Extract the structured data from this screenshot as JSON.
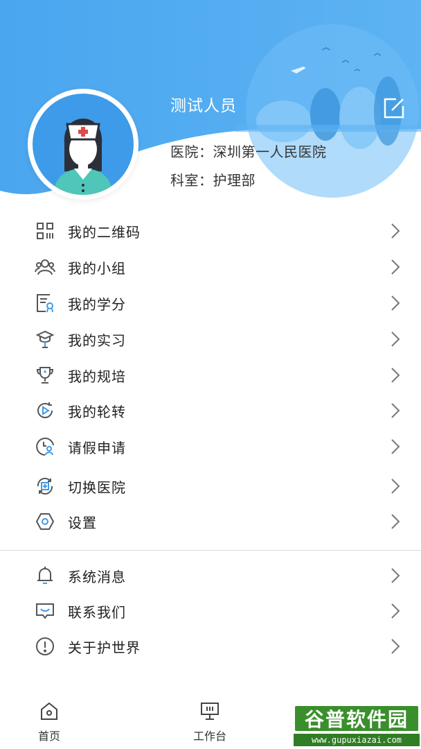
{
  "profile": {
    "name": "测试人员",
    "hospital_label": "医院：",
    "hospital": "深圳第一人民医院",
    "department_label": "科室：",
    "department": "护理部"
  },
  "menu": [
    {
      "label": "我的二维码",
      "icon": "qrcode-icon"
    },
    {
      "label": "我的小组",
      "icon": "group-icon"
    },
    {
      "label": "我的学分",
      "icon": "credit-icon"
    },
    {
      "label": "我的实习",
      "icon": "graduation-cap-icon"
    },
    {
      "label": "我的规培",
      "icon": "trophy-icon"
    },
    {
      "label": "我的轮转",
      "icon": "rotation-icon"
    },
    {
      "label": "请假申请",
      "icon": "leave-clock-user-icon"
    },
    {
      "label": "切换医院",
      "icon": "switch-hospital-icon"
    },
    {
      "label": "设置",
      "icon": "hexagon-settings-icon"
    }
  ],
  "menu2": [
    {
      "label": "系统消息",
      "icon": "bell-icon"
    },
    {
      "label": "联系我们",
      "icon": "contact-message-icon"
    },
    {
      "label": "关于护世界",
      "icon": "info-exclamation-icon"
    }
  ],
  "tabs": [
    {
      "label": "首页",
      "icon": "home-icon"
    },
    {
      "label": "工作台",
      "icon": "workbench-icon"
    }
  ],
  "watermark": {
    "title": "谷普软件园",
    "url": "www.gupuxiazai.com"
  },
  "colors": {
    "header_blue": "#48a6f0",
    "accent": "#3d9be9",
    "icon_gray": "#555555"
  }
}
